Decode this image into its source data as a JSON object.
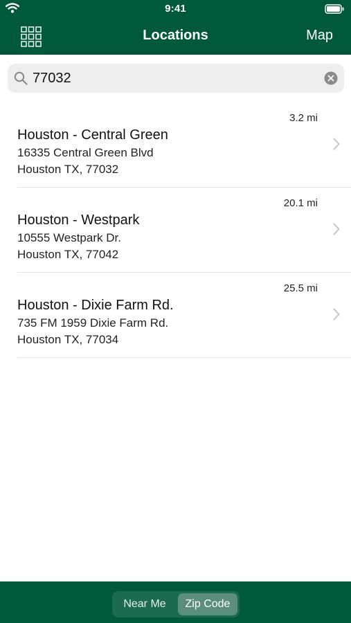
{
  "status_bar": {
    "time": "9:41"
  },
  "nav": {
    "title": "Locations",
    "map_label": "Map"
  },
  "search": {
    "value": "77032"
  },
  "locations": [
    {
      "distance": "3.2 mi",
      "name": "Houston - Central Green",
      "address_line1": "16335 Central Green Blvd",
      "address_line2": "Houston TX, 77032"
    },
    {
      "distance": "20.1 mi",
      "name": "Houston - Westpark",
      "address_line1": "10555 Westpark Dr.",
      "address_line2": "Houston TX, 77042"
    },
    {
      "distance": "25.5 mi",
      "name": "Houston - Dixie Farm Rd.",
      "address_line1": "735 FM 1959 Dixie Farm Rd.",
      "address_line2": "Houston TX, 77034"
    }
  ],
  "segmented_control": {
    "options": [
      "Near Me",
      "Zip Code"
    ],
    "selected": "Zip Code"
  },
  "colors": {
    "brand_green": "#00593b",
    "segment_selected": "#5b8f7c"
  }
}
